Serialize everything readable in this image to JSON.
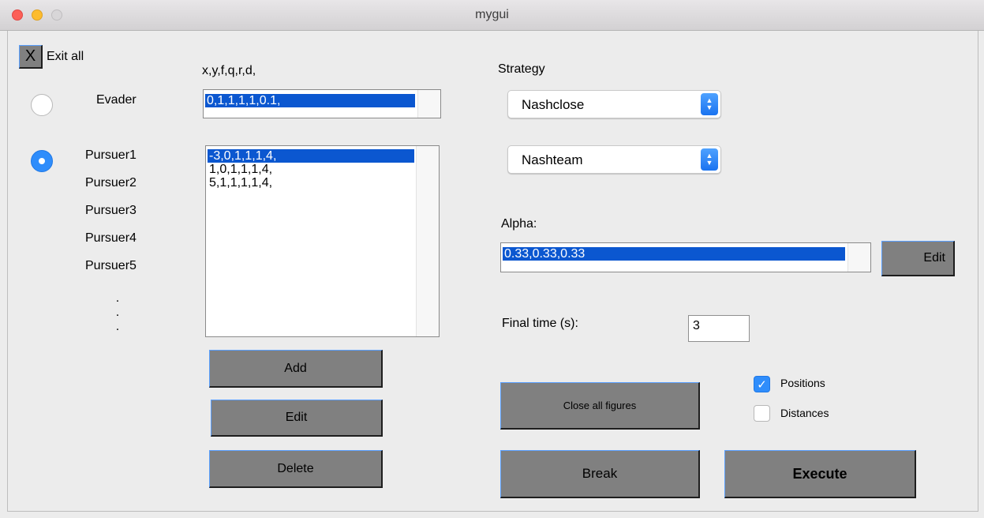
{
  "window": {
    "title": "mygui"
  },
  "exit": {
    "icon_label": "X",
    "label": "Exit all"
  },
  "columns": {
    "params_header": "x,y,f,q,r,d,"
  },
  "evader": {
    "label": "Evader",
    "value": "0,1,1,1,1,0.1,"
  },
  "pursuers": {
    "labels": [
      "Pursuer1",
      "Pursuer2",
      "Pursuer3",
      "Pursuer4",
      "Pursuer5"
    ],
    "more_dots": ".",
    "list": [
      "-3,0,1,1,1,4,",
      "1,0,1,1,1,4,",
      "5,1,1,1,1,4,"
    ]
  },
  "buttons": {
    "add": "Add",
    "edit": "Edit",
    "delete": "Delete",
    "alpha_edit": "Edit",
    "close_figures": "Close all figures",
    "break": "Break",
    "execute": "Execute"
  },
  "strategy": {
    "label": "Strategy",
    "evader_strategy": "Nashclose",
    "pursuer_strategy": "Nashteam"
  },
  "alpha": {
    "label": "Alpha:",
    "value": "0.33,0.33,0.33"
  },
  "final_time": {
    "label": "Final time (s):",
    "value": "3"
  },
  "plots": {
    "positions": {
      "label": "Positions",
      "checked": true
    },
    "distances": {
      "label": "Distances",
      "checked": false
    }
  },
  "colors": {
    "selection": "#0b57d0",
    "button_gray": "#808080",
    "accent_blue": "#2f8dfb"
  }
}
